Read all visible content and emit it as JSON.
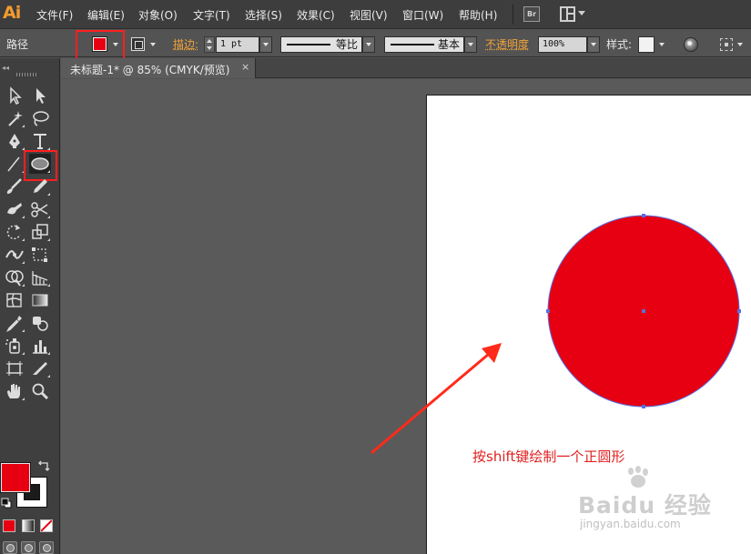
{
  "app": {
    "logo": "Ai"
  },
  "menu": [
    "文件(F)",
    "编辑(E)",
    "对象(O)",
    "文字(T)",
    "选择(S)",
    "效果(C)",
    "视图(V)",
    "窗口(W)",
    "帮助(H)"
  ],
  "menubar_buttons": {
    "bridge": "Br"
  },
  "control_bar": {
    "selection_type": "路径",
    "stroke_label": "描边:",
    "stroke_weight": "1 pt",
    "variable_width_profile": "等比",
    "brush_definition": "基本",
    "opacity_label": "不透明度",
    "opacity_value": "100%",
    "style_label": "样式:"
  },
  "document_tab": {
    "title": "未标题-1* @ 85% (CMYK/预览)",
    "close": "×"
  },
  "canvas": {
    "annotation": "按shift键绘制一个正圆形"
  },
  "watermark": {
    "brand": "Baidu 经验",
    "url": "jingyan.baidu.com"
  },
  "colors": {
    "fill": "#e60012",
    "highlight_box": "#ff1f1f",
    "arrow": "#ff2a1a",
    "selection": "#5a6fe0",
    "menu_accent": "#f29b2f"
  },
  "icons": {
    "tools": [
      "selection-tool-icon",
      "direct-selection-tool-icon",
      "magic-wand-tool-icon",
      "lasso-tool-icon",
      "pen-tool-icon",
      "type-tool-icon",
      "line-segment-tool-icon",
      "ellipse-tool-icon",
      "paintbrush-tool-icon",
      "pencil-tool-icon",
      "blob-brush-tool-icon",
      "scissors-tool-icon",
      "rotate-tool-icon",
      "scale-tool-icon",
      "width-tool-icon",
      "free-transform-tool-icon",
      "shape-builder-tool-icon",
      "perspective-grid-tool-icon",
      "mesh-tool-icon",
      "gradient-tool-icon",
      "eyedropper-tool-icon",
      "blend-tool-icon",
      "symbol-sprayer-tool-icon",
      "column-graph-tool-icon",
      "artboard-tool-icon",
      "slice-tool-icon",
      "hand-tool-icon",
      "zoom-tool-icon"
    ]
  }
}
